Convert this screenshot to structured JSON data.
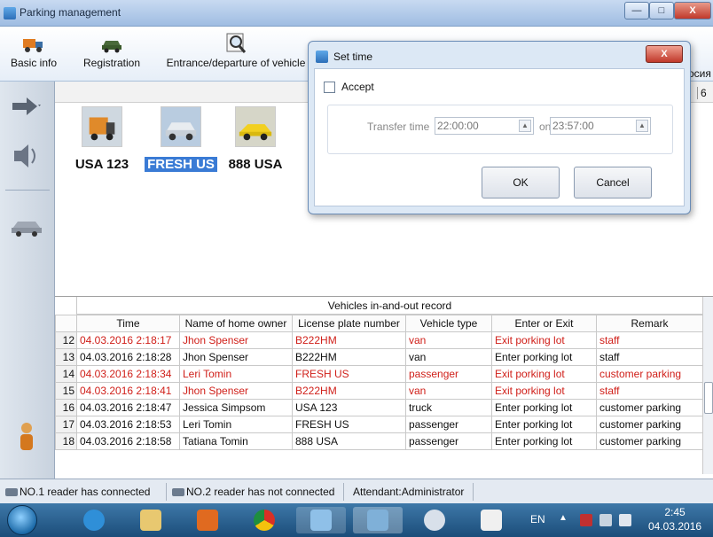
{
  "window": {
    "title": "Parking management"
  },
  "toolbar": {
    "basic_info": "Basic info",
    "registration": "Registration",
    "entrance_departure": "Entrance/departure of vehicle",
    "cut_text": "осия"
  },
  "main": {
    "right_number": "6"
  },
  "vehicles": [
    {
      "label": "USA 123",
      "icon": "truck-icon",
      "selected": false
    },
    {
      "label": "FRESH US",
      "icon": "suv-icon",
      "selected": true
    },
    {
      "label": "888 USA",
      "icon": "sports-car-icon",
      "selected": false
    }
  ],
  "dialog": {
    "title": "Set time",
    "close_label": "X",
    "accept_label": "Accept",
    "transfer_label": "Transfer time",
    "time_from": "22:00:00",
    "on_label": "on",
    "time_to": "23:57:00",
    "ok_label": "OK",
    "cancel_label": "Cancel"
  },
  "table": {
    "title": "Vehicles in-and-out record",
    "columns": [
      "Time",
      "Name of home owner",
      "License plate number",
      "Vehicle type",
      "Enter or Exit",
      "Remark"
    ],
    "rows": [
      {
        "idx": "12",
        "time": "04.03.2016 2:18:17",
        "owner": "Jhon Spenser",
        "plate": "B222HM",
        "type": "van",
        "action": "Exit porking lot",
        "remark": "staff",
        "highlight": true
      },
      {
        "idx": "13",
        "time": "04.03.2016 2:18:28",
        "owner": "Jhon Spenser",
        "plate": "B222HM",
        "type": "van",
        "action": "Enter porking lot",
        "remark": "staff",
        "highlight": false
      },
      {
        "idx": "14",
        "time": "04.03.2016 2:18:34",
        "owner": "Leri Tomin",
        "plate": "FRESH US",
        "type": "passenger",
        "action": "Exit porking lot",
        "remark": "customer parking",
        "highlight": true
      },
      {
        "idx": "15",
        "time": "04.03.2016 2:18:41",
        "owner": "Jhon Spenser",
        "plate": "B222HM",
        "type": "van",
        "action": "Exit porking lot",
        "remark": "staff",
        "highlight": true
      },
      {
        "idx": "16",
        "time": "04.03.2016 2:18:47",
        "owner": "Jessica Simpsom",
        "plate": "USA 123",
        "type": "truck",
        "action": "Enter porking lot",
        "remark": "customer parking",
        "highlight": false
      },
      {
        "idx": "17",
        "time": "04.03.2016 2:18:53",
        "owner": "Leri Tomin",
        "plate": "FRESH US",
        "type": "passenger",
        "action": "Enter porking lot",
        "remark": "customer parking",
        "highlight": false
      },
      {
        "idx": "18",
        "time": "04.03.2016 2:18:58",
        "owner": "Tatiana Tomin",
        "plate": "888 USA",
        "type": "passenger",
        "action": "Enter porking lot",
        "remark": "customer parking",
        "highlight": false
      }
    ]
  },
  "status": {
    "reader1": "NO.1 reader has connected",
    "reader2": "NO.2 reader has not connected",
    "attendant": "Attendant:Administrator"
  },
  "taskbar": {
    "lang": "EN",
    "time": "2:45",
    "date": "04.03.2016"
  },
  "colors": {
    "accent": "#3a7bd5",
    "highlight_text": "#d0201a"
  }
}
